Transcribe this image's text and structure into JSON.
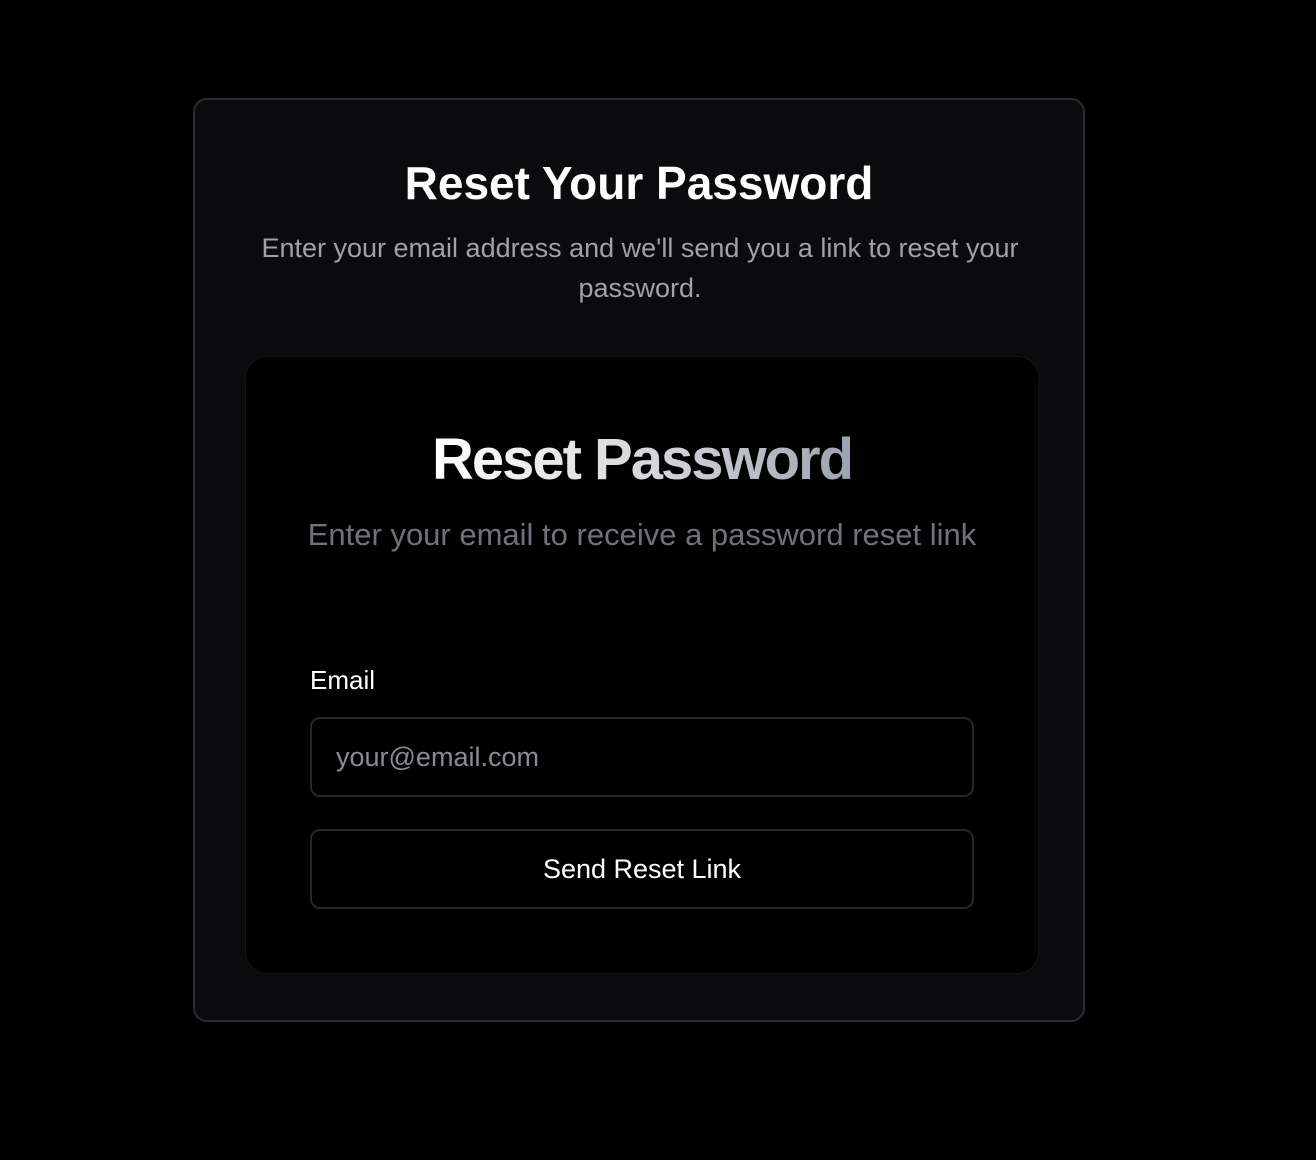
{
  "page": {
    "title": "Reset Your Password",
    "subtitle": "Enter your email address and we'll send you a link to reset your password."
  },
  "form": {
    "title": "Reset Password",
    "subtitle": "Enter your email to receive a password reset link",
    "email_label": "Email",
    "email_value": "",
    "email_placeholder": "your@email.com",
    "submit_label": "Send Reset Link"
  },
  "colors": {
    "background": "#000000",
    "outer_card": "#0b0b0d",
    "border": "#27272a",
    "muted_text": "#a1a1aa"
  }
}
